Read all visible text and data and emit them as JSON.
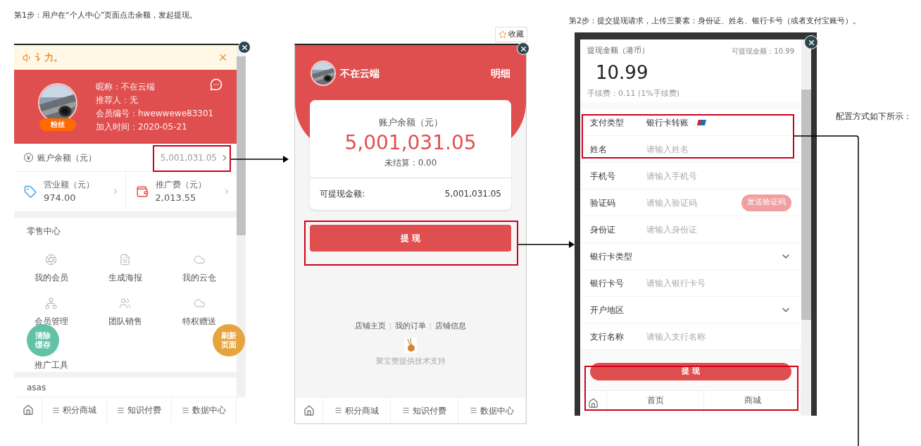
{
  "step1": {
    "caption": "第1步：用户在“个人中心”页面点击余额，发起提现。",
    "notice": "讠力。",
    "profile": {
      "badge": "粉丝",
      "lines": [
        "昵称：不在云端",
        "推荐人：无",
        "会员编号：hwewwewe83301",
        "加入时间：2020-05-21"
      ]
    },
    "balance": {
      "label": "账户余额（元）",
      "value": "5,001,031.05"
    },
    "stats": [
      {
        "kind": "tag",
        "label": "营业额（元）",
        "value": "974.00"
      },
      {
        "kind": "bag",
        "label": "推广费（元）",
        "value": "2,013.55"
      }
    ],
    "section": {
      "title": "零售中心",
      "items": [
        {
          "kind": "aperture",
          "label": "我的会员"
        },
        {
          "kind": "poster",
          "label": "生成海报"
        },
        {
          "kind": "cloud",
          "label": "我的云仓"
        },
        {
          "kind": "tree",
          "label": "会员管理"
        },
        {
          "kind": "team",
          "label": "团队销售"
        },
        {
          "kind": "cloud",
          "label": "特权赠送"
        },
        {
          "kind": "none",
          "label": "推广工具"
        }
      ]
    },
    "floating_buttons": [
      {
        "label": "清除缓存",
        "color": "#62c2a6"
      },
      {
        "label": "刷新页面",
        "color": "#e6a33e"
      }
    ],
    "section2_title": "asas",
    "tabbar": [
      "积分商城",
      "知识付费",
      "数据中心"
    ]
  },
  "step2": {
    "bookmark": "收藏",
    "user_name": "不在云端",
    "detail_link": "明细",
    "card": {
      "label": "账户余额（元）",
      "amount": "5,001,031.05",
      "unsettled": "未结算：0.00",
      "available_label": "可提现金额:",
      "available_value": "5,001,031.05"
    },
    "button": "提 现",
    "footer_links": [
      "店铺主页",
      "我的订单",
      "店铺信息"
    ],
    "support": "聚宝赞提供技术支持",
    "tabbar": [
      "积分商城",
      "知识付费",
      "数据中心"
    ]
  },
  "step3": {
    "caption": "第2步：提交提现请求，上传三要素：身份证、姓名、银行卡号（或者支付宝账号）。",
    "amount_label": "提现金额（港币）",
    "available": "可提现金额：10.99",
    "amount": "10.99",
    "fee": "手续费：0.11 (1%手续费)",
    "rows": [
      {
        "kind": "static",
        "label": "支付类型",
        "value": "银行卡转账"
      },
      {
        "kind": "input",
        "label": "姓名",
        "placeholder": "请输入姓名"
      },
      {
        "kind": "input",
        "label": "手机号",
        "placeholder": "请输入手机号"
      },
      {
        "kind": "code",
        "label": "验证码",
        "placeholder": "请输入验证码",
        "button": "发送验证码"
      },
      {
        "kind": "input",
        "label": "身份证",
        "placeholder": "请输入身份证"
      },
      {
        "kind": "select",
        "label": "银行卡类型"
      },
      {
        "kind": "input",
        "label": "银行卡号",
        "placeholder": "请输入银行卡号"
      },
      {
        "kind": "select",
        "label": "开户地区"
      },
      {
        "kind": "input",
        "label": "支行名称",
        "placeholder": "请输入支行名称"
      }
    ],
    "button": "提 现",
    "tabbar": [
      "首页",
      "商城"
    ]
  },
  "note": "配置方式如下所示："
}
